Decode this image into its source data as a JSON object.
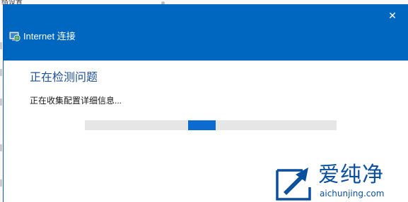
{
  "background_window": {
    "title": "络设置"
  },
  "dialog": {
    "title": "Internet 连接",
    "close_glyph": "✕",
    "heading": "正在检测问题",
    "status": "正在收集配置详细信息...",
    "progress": {
      "indeterminate": true,
      "chunk_position_fraction": 0.41,
      "chunk_width_fraction": 0.11
    }
  },
  "watermark": {
    "brand_cn": "爱纯净",
    "url": "aichunjing.com"
  },
  "colors": {
    "titlebar": "#0067c0",
    "heading": "#1f4e9a",
    "progress_fill": "#0b6bd1",
    "progress_track": "#e6e6e6",
    "watermark": "#0a4f9e"
  },
  "icons": {
    "app": "network-globe-icon",
    "close": "close-icon",
    "watermark": "aichunjing-logo-icon"
  }
}
